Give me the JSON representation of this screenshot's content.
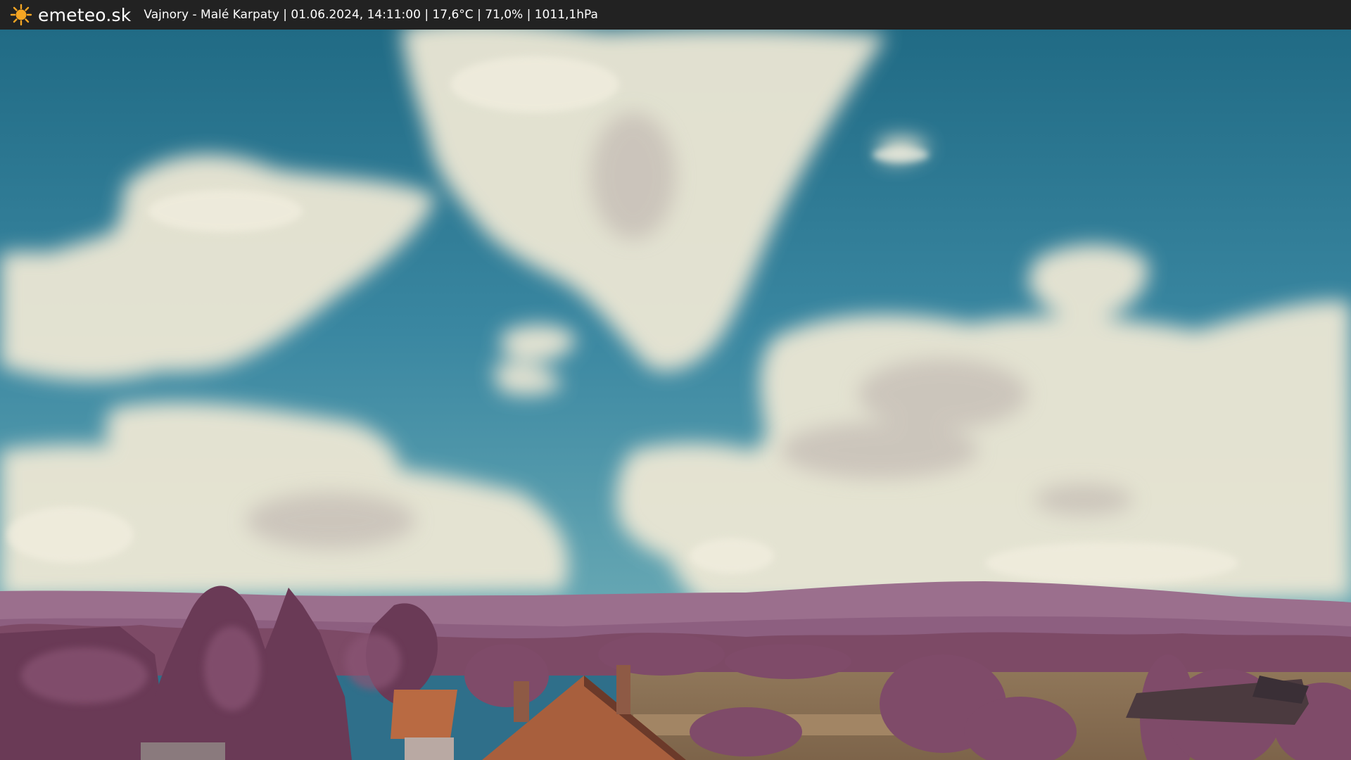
{
  "topbar": {
    "brand": "emeteo.sk",
    "info": "Vajnory - Malé Karpaty | 01.06.2024, 14:11:00 | 17,6°C | 71,0% | 1011,1hPa",
    "logo_icon": "sun-icon"
  },
  "colors": {
    "bar_background": "#222222",
    "bar_text": "#ffffff",
    "sun": "#f5a623",
    "sky_top": "#1f6a86",
    "sky_low": "#3f8aa3",
    "cloud": "#ece7d4",
    "hills": "#9a6e8c",
    "trees": "#6b3b56",
    "field": "#8c7358",
    "roof": "#b86a43"
  }
}
